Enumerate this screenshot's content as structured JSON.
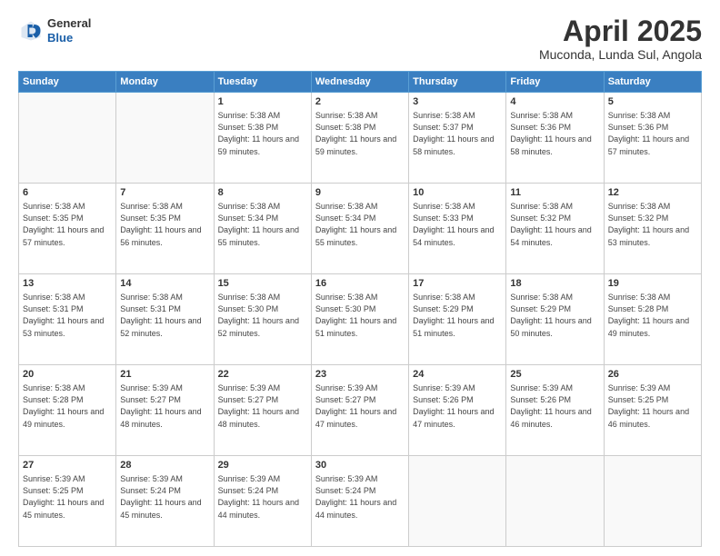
{
  "header": {
    "logo": {
      "general": "General",
      "blue": "Blue"
    },
    "title": "April 2025",
    "location": "Muconda, Lunda Sul, Angola"
  },
  "calendar": {
    "days_of_week": [
      "Sunday",
      "Monday",
      "Tuesday",
      "Wednesday",
      "Thursday",
      "Friday",
      "Saturday"
    ],
    "weeks": [
      [
        {
          "day": "",
          "info": ""
        },
        {
          "day": "",
          "info": ""
        },
        {
          "day": "1",
          "info": "Sunrise: 5:38 AM\nSunset: 5:38 PM\nDaylight: 11 hours and 59 minutes."
        },
        {
          "day": "2",
          "info": "Sunrise: 5:38 AM\nSunset: 5:38 PM\nDaylight: 11 hours and 59 minutes."
        },
        {
          "day": "3",
          "info": "Sunrise: 5:38 AM\nSunset: 5:37 PM\nDaylight: 11 hours and 58 minutes."
        },
        {
          "day": "4",
          "info": "Sunrise: 5:38 AM\nSunset: 5:36 PM\nDaylight: 11 hours and 58 minutes."
        },
        {
          "day": "5",
          "info": "Sunrise: 5:38 AM\nSunset: 5:36 PM\nDaylight: 11 hours and 57 minutes."
        }
      ],
      [
        {
          "day": "6",
          "info": "Sunrise: 5:38 AM\nSunset: 5:35 PM\nDaylight: 11 hours and 57 minutes."
        },
        {
          "day": "7",
          "info": "Sunrise: 5:38 AM\nSunset: 5:35 PM\nDaylight: 11 hours and 56 minutes."
        },
        {
          "day": "8",
          "info": "Sunrise: 5:38 AM\nSunset: 5:34 PM\nDaylight: 11 hours and 55 minutes."
        },
        {
          "day": "9",
          "info": "Sunrise: 5:38 AM\nSunset: 5:34 PM\nDaylight: 11 hours and 55 minutes."
        },
        {
          "day": "10",
          "info": "Sunrise: 5:38 AM\nSunset: 5:33 PM\nDaylight: 11 hours and 54 minutes."
        },
        {
          "day": "11",
          "info": "Sunrise: 5:38 AM\nSunset: 5:32 PM\nDaylight: 11 hours and 54 minutes."
        },
        {
          "day": "12",
          "info": "Sunrise: 5:38 AM\nSunset: 5:32 PM\nDaylight: 11 hours and 53 minutes."
        }
      ],
      [
        {
          "day": "13",
          "info": "Sunrise: 5:38 AM\nSunset: 5:31 PM\nDaylight: 11 hours and 53 minutes."
        },
        {
          "day": "14",
          "info": "Sunrise: 5:38 AM\nSunset: 5:31 PM\nDaylight: 11 hours and 52 minutes."
        },
        {
          "day": "15",
          "info": "Sunrise: 5:38 AM\nSunset: 5:30 PM\nDaylight: 11 hours and 52 minutes."
        },
        {
          "day": "16",
          "info": "Sunrise: 5:38 AM\nSunset: 5:30 PM\nDaylight: 11 hours and 51 minutes."
        },
        {
          "day": "17",
          "info": "Sunrise: 5:38 AM\nSunset: 5:29 PM\nDaylight: 11 hours and 51 minutes."
        },
        {
          "day": "18",
          "info": "Sunrise: 5:38 AM\nSunset: 5:29 PM\nDaylight: 11 hours and 50 minutes."
        },
        {
          "day": "19",
          "info": "Sunrise: 5:38 AM\nSunset: 5:28 PM\nDaylight: 11 hours and 49 minutes."
        }
      ],
      [
        {
          "day": "20",
          "info": "Sunrise: 5:38 AM\nSunset: 5:28 PM\nDaylight: 11 hours and 49 minutes."
        },
        {
          "day": "21",
          "info": "Sunrise: 5:39 AM\nSunset: 5:27 PM\nDaylight: 11 hours and 48 minutes."
        },
        {
          "day": "22",
          "info": "Sunrise: 5:39 AM\nSunset: 5:27 PM\nDaylight: 11 hours and 48 minutes."
        },
        {
          "day": "23",
          "info": "Sunrise: 5:39 AM\nSunset: 5:27 PM\nDaylight: 11 hours and 47 minutes."
        },
        {
          "day": "24",
          "info": "Sunrise: 5:39 AM\nSunset: 5:26 PM\nDaylight: 11 hours and 47 minutes."
        },
        {
          "day": "25",
          "info": "Sunrise: 5:39 AM\nSunset: 5:26 PM\nDaylight: 11 hours and 46 minutes."
        },
        {
          "day": "26",
          "info": "Sunrise: 5:39 AM\nSunset: 5:25 PM\nDaylight: 11 hours and 46 minutes."
        }
      ],
      [
        {
          "day": "27",
          "info": "Sunrise: 5:39 AM\nSunset: 5:25 PM\nDaylight: 11 hours and 45 minutes."
        },
        {
          "day": "28",
          "info": "Sunrise: 5:39 AM\nSunset: 5:24 PM\nDaylight: 11 hours and 45 minutes."
        },
        {
          "day": "29",
          "info": "Sunrise: 5:39 AM\nSunset: 5:24 PM\nDaylight: 11 hours and 44 minutes."
        },
        {
          "day": "30",
          "info": "Sunrise: 5:39 AM\nSunset: 5:24 PM\nDaylight: 11 hours and 44 minutes."
        },
        {
          "day": "",
          "info": ""
        },
        {
          "day": "",
          "info": ""
        },
        {
          "day": "",
          "info": ""
        }
      ]
    ]
  }
}
